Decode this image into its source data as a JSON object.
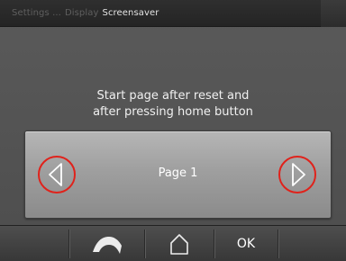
{
  "breadcrumb": {
    "settings": "Settings ...",
    "display": "Display",
    "current": "Screensaver"
  },
  "caption": {
    "line1": "Start page after reset and",
    "line2": "after pressing home button"
  },
  "selector": {
    "value": "Page 1"
  },
  "toolbar": {
    "ok_label": "OK"
  },
  "icons": {
    "previous": "chevron-left-icon",
    "next": "chevron-right-icon",
    "back": "back-arrow-icon",
    "home": "home-icon"
  },
  "colors": {
    "highlight": "#e0221b",
    "background": "#555555",
    "text": "#ffffff"
  }
}
